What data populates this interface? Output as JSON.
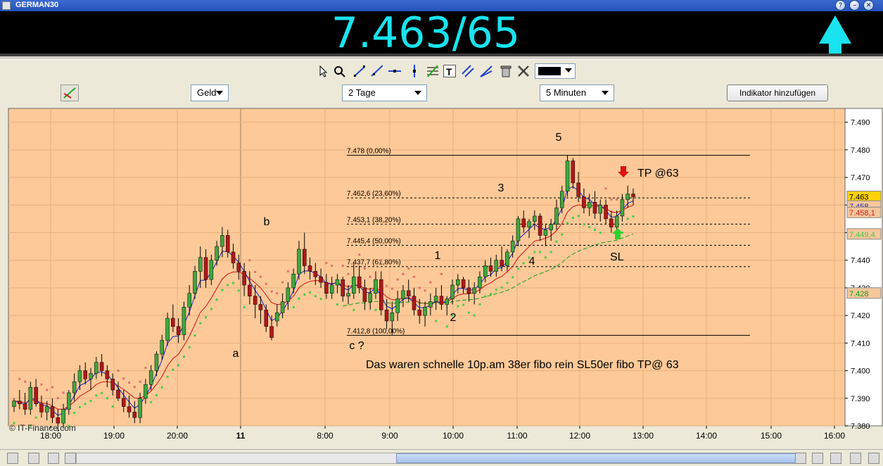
{
  "window": {
    "title": "GERMAN30"
  },
  "quote": {
    "price": "7.463/65",
    "direction": "up",
    "color": "#19e3ee"
  },
  "toolbar": {
    "tools": [
      "pointer-icon",
      "zoom-icon",
      "trendline-icon",
      "ray-icon",
      "horizontal-line-icon",
      "vertical-line-icon",
      "fibonacci-icon",
      "text-icon",
      "channel-icon",
      "channel-fan-icon",
      "trash-icon",
      "tools-icon"
    ],
    "color_value": "#000000"
  },
  "controls": {
    "price_type": "Geld",
    "range": "2 Tage",
    "interval": "5 Minuten",
    "add_indicator_label": "Indikator hinzufügen"
  },
  "chart_data": {
    "type": "candlestick",
    "ylim": [
      7.38,
      7.495
    ],
    "y_ticks": [
      "7.490",
      "7.480",
      "7.470",
      "7.460",
      "7.450",
      "7.440",
      "7.430",
      "7.420",
      "7.410",
      "7.400",
      "7.390",
      "7.380"
    ],
    "x_ticks": [
      "18:00",
      "19:00",
      "20:00",
      "11",
      "8:00",
      "9:00",
      "10:00",
      "11:00",
      "12:00",
      "13:00",
      "14:00",
      "15:00",
      "16:00"
    ],
    "price_labels": [
      {
        "text": "7.463",
        "value": 7.463,
        "bg": "#ffd200",
        "color": "#000000"
      },
      {
        "text": "7.458",
        "value": 7.4595,
        "bg": "#f6c79c",
        "color": "#2a2ab8"
      },
      {
        "text": "7.458,1",
        "value": 7.4572,
        "bg": "#f6c79c",
        "color": "#cc2222"
      },
      {
        "text": "7.449,4",
        "value": 7.4494,
        "bg": "#f6c79c",
        "color": "#44cc44"
      },
      {
        "text": "7.428",
        "value": 7.428,
        "bg": "#f6c79c",
        "color": "#119911"
      }
    ],
    "fibonacci_levels": [
      {
        "label": "7.478 (0,00%)",
        "value": 7.478
      },
      {
        "label": "7.462,6 (23,60%)",
        "value": 7.4626
      },
      {
        "label": "7.453,1 (38,20%)",
        "value": 7.4531
      },
      {
        "label": "7.445,4 (50,00%)",
        "value": 7.4454
      },
      {
        "label": "7.437,7 (61,80%)",
        "value": 7.4377
      },
      {
        "label": "7.412,8 (100,00%)",
        "value": 7.4128
      }
    ],
    "wave_labels": [
      "5",
      "3",
      "1",
      "4",
      "2",
      "b",
      "a",
      "c ?"
    ],
    "annotations": {
      "tp": "TP @63",
      "sl": "SL",
      "comment": "Das waren schnelle 10p.am 38er fibo rein SL50er fibo TP@ 63"
    },
    "watermark": "© IT-Finance.com",
    "candles": [
      [
        7.387,
        7.39,
        7.385,
        7.389
      ],
      [
        7.389,
        7.393,
        7.386,
        7.388
      ],
      [
        7.388,
        7.392,
        7.384,
        7.386
      ],
      [
        7.386,
        7.396,
        7.384,
        7.394
      ],
      [
        7.394,
        7.397,
        7.387,
        7.388
      ],
      [
        7.388,
        7.391,
        7.383,
        7.385
      ],
      [
        7.385,
        7.389,
        7.382,
        7.387
      ],
      [
        7.387,
        7.39,
        7.381,
        7.383
      ],
      [
        7.383,
        7.386,
        7.378,
        7.381
      ],
      [
        7.381,
        7.388,
        7.379,
        7.386
      ],
      [
        7.386,
        7.393,
        7.384,
        7.392
      ],
      [
        7.392,
        7.399,
        7.389,
        7.396
      ],
      [
        7.396,
        7.402,
        7.393,
        7.4
      ],
      [
        7.4,
        7.403,
        7.395,
        7.397
      ],
      [
        7.397,
        7.401,
        7.393,
        7.399
      ],
      [
        7.399,
        7.405,
        7.397,
        7.403
      ],
      [
        7.403,
        7.406,
        7.398,
        7.4
      ],
      [
        7.4,
        7.402,
        7.394,
        7.397
      ],
      [
        7.397,
        7.399,
        7.391,
        7.393
      ],
      [
        7.393,
        7.396,
        7.389,
        7.39
      ],
      [
        7.39,
        7.393,
        7.385,
        7.387
      ],
      [
        7.387,
        7.391,
        7.383,
        7.385
      ],
      [
        7.385,
        7.389,
        7.381,
        7.383
      ],
      [
        7.383,
        7.392,
        7.381,
        7.39
      ],
      [
        7.39,
        7.397,
        7.388,
        7.395
      ],
      [
        7.395,
        7.402,
        7.393,
        7.4
      ],
      [
        7.4,
        7.407,
        7.398,
        7.406
      ],
      [
        7.406,
        7.413,
        7.404,
        7.411
      ],
      [
        7.411,
        7.421,
        7.409,
        7.419
      ],
      [
        7.419,
        7.424,
        7.414,
        7.416
      ],
      [
        7.416,
        7.419,
        7.41,
        7.413
      ],
      [
        7.413,
        7.425,
        7.411,
        7.423
      ],
      [
        7.423,
        7.431,
        7.42,
        7.428
      ],
      [
        7.428,
        7.438,
        7.426,
        7.436
      ],
      [
        7.436,
        7.445,
        7.43,
        7.441
      ],
      [
        7.441,
        7.444,
        7.43,
        7.433
      ],
      [
        7.433,
        7.442,
        7.431,
        7.44
      ],
      [
        7.44,
        7.447,
        7.438,
        7.445
      ],
      [
        7.445,
        7.452,
        7.441,
        7.449
      ],
      [
        7.449,
        7.451,
        7.441,
        7.443
      ],
      [
        7.443,
        7.446,
        7.437,
        7.439
      ],
      [
        7.439,
        7.442,
        7.433,
        7.436
      ],
      [
        7.436,
        7.439,
        7.427,
        7.431
      ],
      [
        7.431,
        7.436,
        7.424,
        7.427
      ],
      [
        7.427,
        7.431,
        7.419,
        7.424
      ],
      [
        7.424,
        7.427,
        7.417,
        7.422
      ],
      [
        7.422,
        7.424,
        7.414,
        7.416
      ],
      [
        7.416,
        7.42,
        7.411,
        7.412
      ],
      [
        7.418,
        7.424,
        7.416,
        7.421
      ],
      [
        7.421,
        7.428,
        7.419,
        7.425
      ],
      [
        7.425,
        7.432,
        7.422,
        7.43
      ],
      [
        7.43,
        7.437,
        7.428,
        7.435
      ],
      [
        7.435,
        7.447,
        7.433,
        7.444
      ],
      [
        7.444,
        7.45,
        7.435,
        7.438
      ],
      [
        7.438,
        7.441,
        7.433,
        7.436
      ],
      [
        7.436,
        7.439,
        7.431,
        7.434
      ],
      [
        7.434,
        7.437,
        7.43,
        7.432
      ],
      [
        7.432,
        7.435,
        7.426,
        7.428
      ],
      [
        7.428,
        7.434,
        7.426,
        7.431
      ],
      [
        7.431,
        7.435,
        7.428,
        7.433
      ],
      [
        7.433,
        7.434,
        7.425,
        7.427
      ],
      [
        7.427,
        7.431,
        7.424,
        7.428
      ],
      [
        7.428,
        7.439,
        7.426,
        7.434
      ],
      [
        7.434,
        7.438,
        7.428,
        7.43
      ],
      [
        7.43,
        7.433,
        7.422,
        7.425
      ],
      [
        7.425,
        7.43,
        7.422,
        7.428
      ],
      [
        7.428,
        7.436,
        7.426,
        7.433
      ],
      [
        7.433,
        7.436,
        7.42,
        7.422
      ],
      [
        7.422,
        7.426,
        7.415,
        7.418
      ],
      [
        7.418,
        7.425,
        7.413,
        7.421
      ],
      [
        7.421,
        7.429,
        7.418,
        7.426
      ],
      [
        7.426,
        7.431,
        7.423,
        7.429
      ],
      [
        7.429,
        7.433,
        7.425,
        7.427
      ],
      [
        7.427,
        7.43,
        7.42,
        7.422
      ],
      [
        7.422,
        7.426,
        7.417,
        7.42
      ],
      [
        7.42,
        7.425,
        7.416,
        7.423
      ],
      [
        7.423,
        7.428,
        7.42,
        7.425
      ],
      [
        7.425,
        7.43,
        7.422,
        7.427
      ],
      [
        7.427,
        7.431,
        7.422,
        7.424
      ],
      [
        7.424,
        7.427,
        7.42,
        7.426
      ],
      [
        7.426,
        7.433,
        7.424,
        7.431
      ],
      [
        7.431,
        7.435,
        7.428,
        7.433
      ],
      [
        7.433,
        7.434,
        7.428,
        7.43
      ],
      [
        7.43,
        7.433,
        7.425,
        7.428
      ],
      [
        7.428,
        7.432,
        7.424,
        7.43
      ],
      [
        7.43,
        7.436,
        7.428,
        7.434
      ],
      [
        7.434,
        7.44,
        7.432,
        7.438
      ],
      [
        7.438,
        7.441,
        7.434,
        7.436
      ],
      [
        7.436,
        7.442,
        7.434,
        7.44
      ],
      [
        7.44,
        7.445,
        7.436,
        7.438
      ],
      [
        7.438,
        7.444,
        7.436,
        7.443
      ],
      [
        7.443,
        7.449,
        7.441,
        7.447
      ],
      [
        7.447,
        7.456,
        7.445,
        7.455
      ],
      [
        7.455,
        7.458,
        7.45,
        7.452
      ],
      [
        7.452,
        7.455,
        7.448,
        7.454
      ],
      [
        7.454,
        7.458,
        7.451,
        7.456
      ],
      [
        7.456,
        7.457,
        7.447,
        7.449
      ],
      [
        7.449,
        7.453,
        7.445,
        7.451
      ],
      [
        7.451,
        7.455,
        7.447,
        7.453
      ],
      [
        7.453,
        7.462,
        7.451,
        7.459
      ],
      [
        7.459,
        7.467,
        7.457,
        7.465
      ],
      [
        7.465,
        7.478,
        7.463,
        7.476
      ],
      [
        7.476,
        7.477,
        7.466,
        7.468
      ],
      [
        7.468,
        7.472,
        7.461,
        7.463
      ],
      [
        7.463,
        7.466,
        7.457,
        7.459
      ],
      [
        7.459,
        7.464,
        7.456,
        7.461
      ],
      [
        7.461,
        7.465,
        7.455,
        7.457
      ],
      [
        7.457,
        7.462,
        7.454,
        7.46
      ],
      [
        7.46,
        7.462,
        7.453,
        7.455
      ],
      [
        7.455,
        7.458,
        7.45,
        7.452
      ],
      [
        7.452,
        7.458,
        7.449,
        7.456
      ],
      [
        7.456,
        7.464,
        7.454,
        7.462
      ],
      [
        7.462,
        7.467,
        7.459,
        7.464
      ],
      [
        7.464,
        7.466,
        7.46,
        7.463
      ]
    ]
  }
}
